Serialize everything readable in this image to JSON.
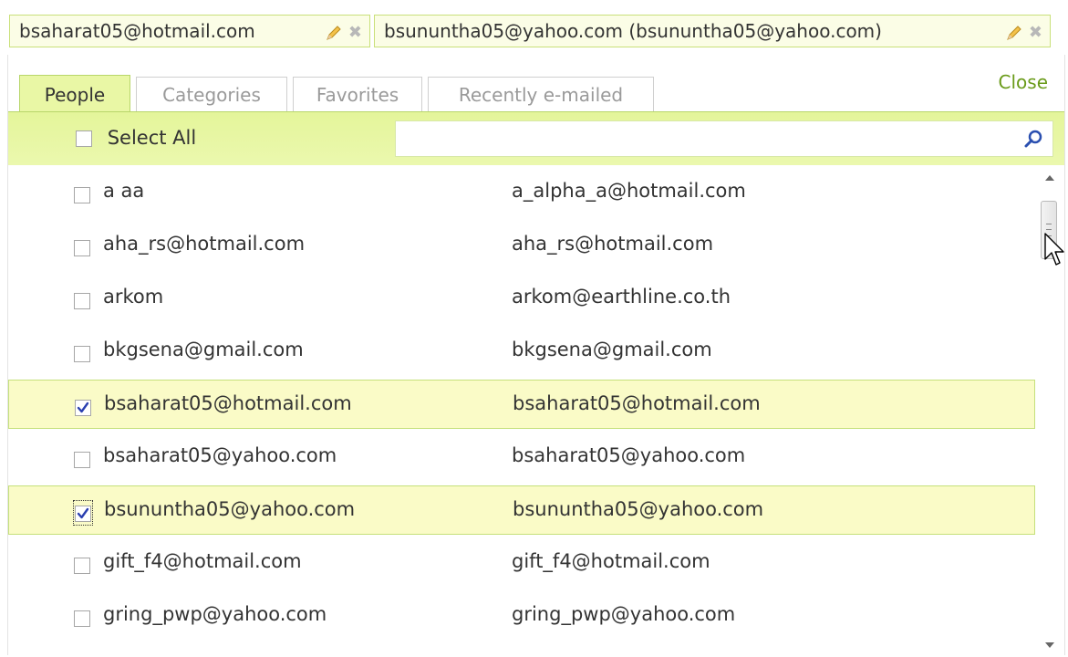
{
  "recipients": [
    {
      "label": "bsaharat05@hotmail.com"
    },
    {
      "label": "bsununtha05@yahoo.com  (bsununtha05@yahoo.com)"
    }
  ],
  "tabs": [
    {
      "label": "People",
      "active": true
    },
    {
      "label": "Categories",
      "active": false
    },
    {
      "label": "Favorites",
      "active": false
    },
    {
      "label": "Recently e-mailed",
      "active": false
    }
  ],
  "close_label": "Close",
  "select_all": {
    "label": "Select All",
    "checked": false
  },
  "search": {
    "value": "",
    "placeholder": ""
  },
  "contacts": [
    {
      "name": "a aa",
      "email": "a_alpha_a@hotmail.com",
      "checked": false
    },
    {
      "name": "aha_rs@hotmail.com",
      "email": "aha_rs@hotmail.com",
      "checked": false
    },
    {
      "name": "arkom",
      "email": "arkom@earthline.co.th",
      "checked": false
    },
    {
      "name": "bkgsena@gmail.com",
      "email": "bkgsena@gmail.com",
      "checked": false
    },
    {
      "name": "bsaharat05@hotmail.com",
      "email": "bsaharat05@hotmail.com",
      "checked": true
    },
    {
      "name": "bsaharat05@yahoo.com",
      "email": "bsaharat05@yahoo.com",
      "checked": false
    },
    {
      "name": "bsununtha05@yahoo.com",
      "email": "bsununtha05@yahoo.com",
      "checked": true,
      "focused": true
    },
    {
      "name": "gift_f4@hotmail.com",
      "email": "gift_f4@hotmail.com",
      "checked": false
    },
    {
      "name": "gring_pwp@yahoo.com",
      "email": "gring_pwp@yahoo.com",
      "checked": false
    }
  ],
  "icons": {
    "edit": "pencil-icon",
    "remove": "close-icon",
    "search": "magnifier-icon",
    "scroll": "scroll-grip-icon"
  },
  "colors": {
    "accent": "#e9f7a5",
    "selected_row": "#fafbc7",
    "link": "#6a9b1a",
    "check": "#2a3fb0"
  }
}
